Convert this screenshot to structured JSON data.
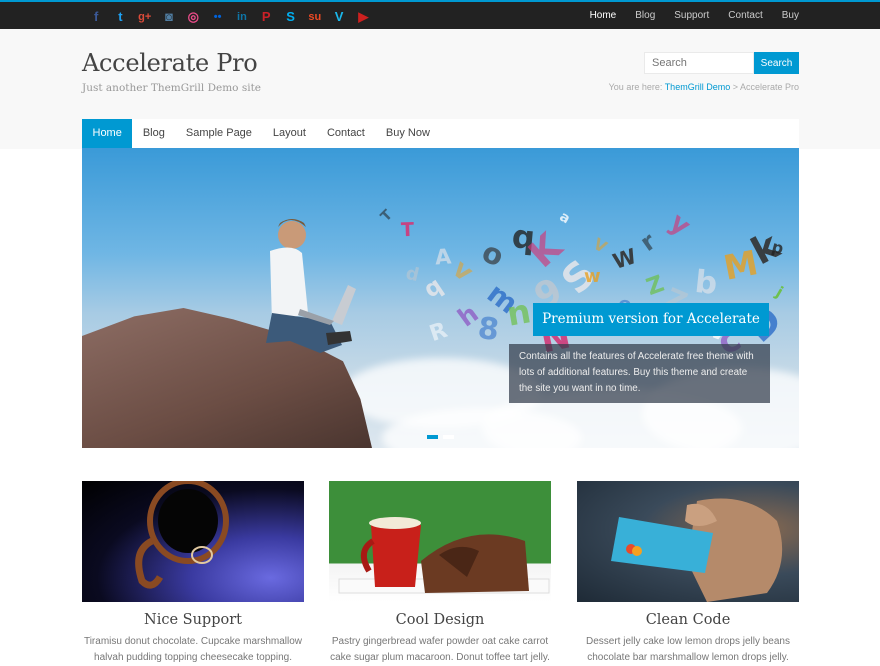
{
  "topbar": {
    "social_icons": [
      {
        "name": "facebook-icon",
        "glyph": "f",
        "color": "#3b5998"
      },
      {
        "name": "twitter-icon",
        "glyph": "t",
        "color": "#1da1f2"
      },
      {
        "name": "google-plus-icon",
        "glyph": "g+",
        "color": "#dd4b39"
      },
      {
        "name": "instagram-icon",
        "glyph": "◙",
        "color": "#517fa4"
      },
      {
        "name": "dribbble-icon",
        "glyph": "◎",
        "color": "#ea4c89"
      },
      {
        "name": "flickr-icon",
        "glyph": "••",
        "color": "#0063dc"
      },
      {
        "name": "linkedin-icon",
        "glyph": "in",
        "color": "#0e76a8"
      },
      {
        "name": "pinterest-icon",
        "glyph": "P",
        "color": "#cb2027"
      },
      {
        "name": "skype-icon",
        "glyph": "S",
        "color": "#00aff0"
      },
      {
        "name": "stumbleupon-icon",
        "glyph": "su",
        "color": "#eb4924"
      },
      {
        "name": "vimeo-icon",
        "glyph": "V",
        "color": "#1ab7ea"
      },
      {
        "name": "youtube-icon",
        "glyph": "▶",
        "color": "#cd201f"
      }
    ],
    "nav": [
      "Home",
      "Blog",
      "Support",
      "Contact",
      "Buy"
    ]
  },
  "header": {
    "site_title": "Accelerate Pro",
    "tagline": "Just another ThemGrill Demo site",
    "search_placeholder": "Search",
    "search_button": "Search",
    "breadcrumb_prefix": "You are here: ",
    "breadcrumb_link": "ThemGrill Demo",
    "breadcrumb_separator": " > ",
    "breadcrumb_current": "Accelerate Pro"
  },
  "main_nav": [
    "Home",
    "Blog",
    "Sample Page",
    "Layout",
    "Contact",
    "Buy Now"
  ],
  "slider": {
    "caption_title": "Premium version for Accelerate",
    "caption_desc": "Contains all the features of Accelerate free theme with lots of additional features. Buy this theme and create the site you want in no time.",
    "slide_count": 2,
    "active_slide": 1
  },
  "features": [
    {
      "title": "Nice Support",
      "text": "Tiramisu donut chocolate. Cupcake marshmallow halvah pudding topping cheesecake topping."
    },
    {
      "title": "Cool Design",
      "text": "Pastry gingerbread wafer powder oat cake carrot cake sugar plum macaroon. Donut toffee tart jelly."
    },
    {
      "title": "Clean Code",
      "text": "Dessert jelly cake low lemon drops jelly beans chocolate bar marshmallow lemon drops jelly."
    }
  ],
  "colors": {
    "accent": "#0099d2",
    "topbar_bg": "#222222",
    "header_bg": "#f8f8f8"
  }
}
